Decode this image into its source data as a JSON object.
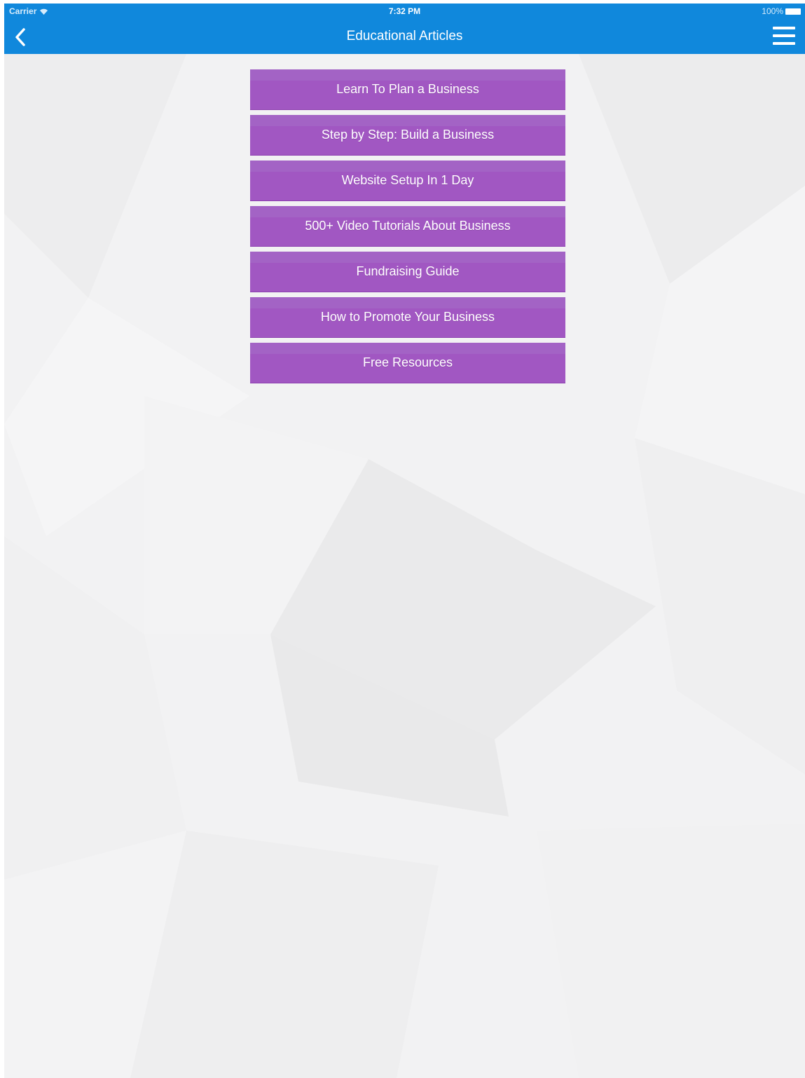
{
  "status_bar": {
    "carrier": "Carrier",
    "time": "7:32 PM",
    "battery": "100%"
  },
  "nav": {
    "title": "Educational Articles",
    "back_icon": "chevron-left-icon",
    "menu_icon": "hamburger-menu-icon"
  },
  "menu": {
    "items": [
      {
        "label": "Learn To Plan a Business"
      },
      {
        "label": "Step by Step: Build a Business"
      },
      {
        "label": "Website Setup In 1 Day"
      },
      {
        "label": "500+ Video Tutorials About Business"
      },
      {
        "label": "Fundraising Guide"
      },
      {
        "label": "How to Promote Your Business"
      },
      {
        "label": "Free Resources"
      }
    ]
  },
  "colors": {
    "nav_bar": "#1088dc",
    "button": "#a157c2",
    "background": "#f2f2f3"
  }
}
